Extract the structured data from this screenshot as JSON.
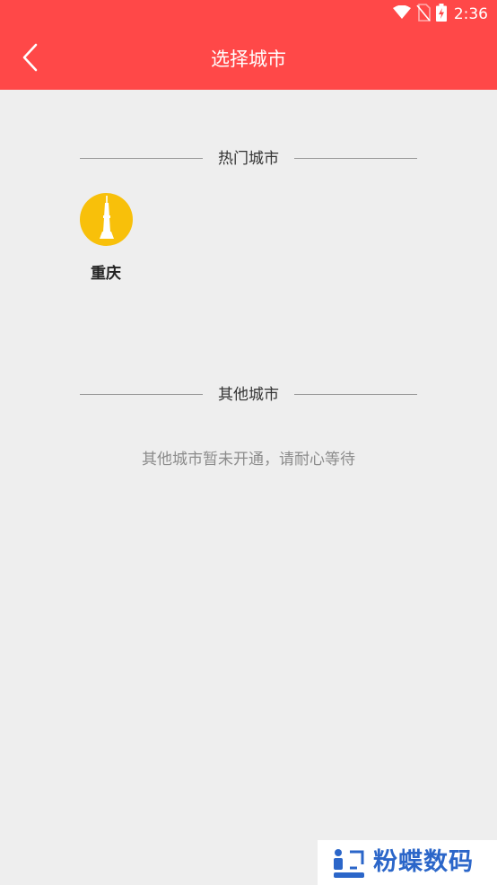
{
  "status_bar": {
    "time": "2:36",
    "icons": [
      "wifi-icon",
      "no-sim-icon",
      "battery-charging-icon"
    ]
  },
  "header": {
    "title": "选择城市",
    "back_icon": "chevron-left-icon",
    "background_color": "#ff4848"
  },
  "hot_cities": {
    "heading": "热门城市",
    "items": [
      {
        "label": "重庆",
        "icon": "tower-icon",
        "icon_color": "#f8c00a"
      }
    ]
  },
  "other_cities": {
    "heading": "其他城市",
    "empty_message": "其他城市暂未开通，请耐心等待"
  },
  "watermark": {
    "text": "粉蝶数码",
    "color": "#2b66c9"
  }
}
